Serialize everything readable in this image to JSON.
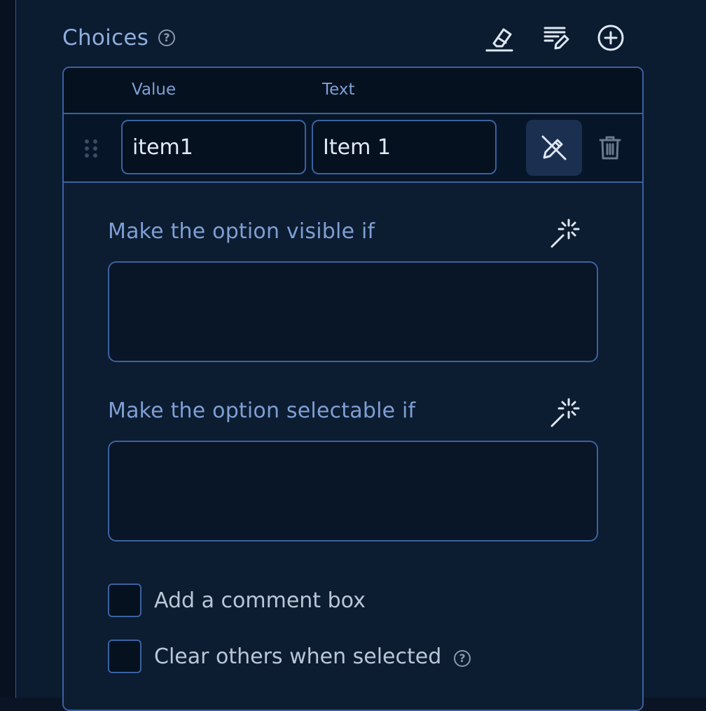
{
  "header": {
    "title": "Choices",
    "help_glyph": "?"
  },
  "toolbar": {
    "icons": [
      "eraser-icon",
      "edit-list-icon",
      "plus-circle-icon"
    ]
  },
  "table": {
    "columns": [
      "Value",
      "Text"
    ],
    "rows": [
      {
        "value": "item1",
        "text": "Item 1"
      }
    ]
  },
  "detail": {
    "visible_if_label": "Make the option visible if",
    "selectable_if_label": "Make the option selectable if",
    "visible_if_value": "",
    "selectable_if_value": "",
    "checkboxes": [
      {
        "label": "Add a comment box",
        "checked": false
      },
      {
        "label": "Clear others when selected",
        "checked": false,
        "help_glyph": "?"
      }
    ]
  },
  "colors": {
    "background": "#0b1b30",
    "accent": "#3b62a0",
    "label": "#7f9fd3",
    "text": "#e2ebf7"
  }
}
